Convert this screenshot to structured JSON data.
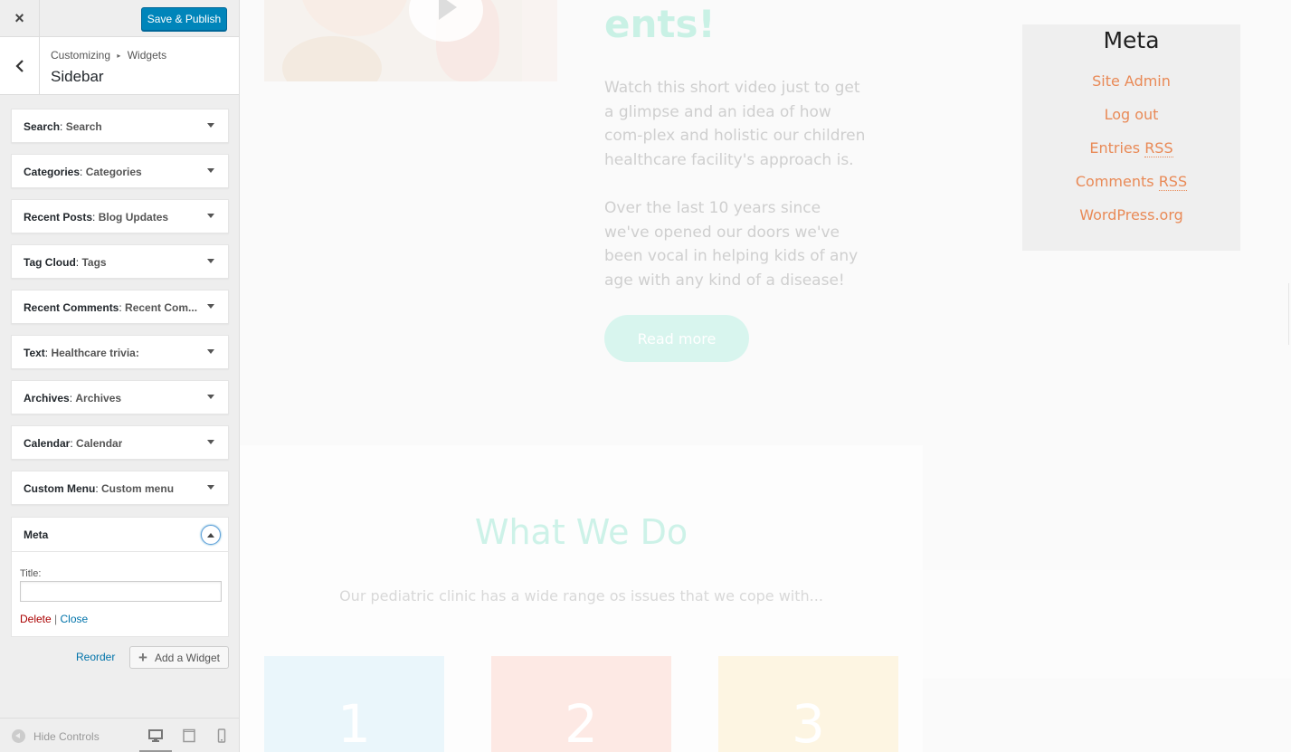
{
  "customizer": {
    "close_icon": "×",
    "save_label": "Save & Publish",
    "breadcrumb": [
      "Customizing",
      "Widgets"
    ],
    "breadcrumb_sep": "▸",
    "section_title": "Sidebar",
    "widgets": [
      {
        "name": "Search",
        "title": "Search"
      },
      {
        "name": "Categories",
        "title": "Categories"
      },
      {
        "name": "Recent Posts",
        "title": "Blog Updates"
      },
      {
        "name": "Tag Cloud",
        "title": "Tags"
      },
      {
        "name": "Recent Comments",
        "title": "Recent Com..."
      },
      {
        "name": "Text",
        "title": "Healthcare trivia:"
      },
      {
        "name": "Archives",
        "title": "Archives"
      },
      {
        "name": "Calendar",
        "title": "Calendar"
      },
      {
        "name": "Custom Menu",
        "title": "Custom menu"
      }
    ],
    "open_widget": {
      "name": "Meta",
      "field_label": "Title:",
      "field_value": "",
      "delete_label": "Delete",
      "separator": "|",
      "close_label": "Close"
    },
    "reorder_label": "Reorder",
    "add_widget_label": "Add a Widget",
    "hide_controls_label": "Hide Controls",
    "devices": [
      "desktop-icon",
      "tablet-icon",
      "mobile-icon"
    ],
    "accent_color": "#0085ba"
  },
  "preview": {
    "headline_fragment": "ents!",
    "paragraph_1": "Watch this short video just to get a glimpse and an idea of how com-plex and holistic our children healthcare facility's approach is.",
    "paragraph_2": "Over the last 10 years since we've opened our doors we've been vocal in helping kids of any age with any kind of a disease!",
    "read_more": "Read more",
    "meta_widget": {
      "title": "Meta",
      "links": [
        {
          "text": "Site Admin"
        },
        {
          "text": "Log out"
        },
        {
          "text": "Entries ",
          "abbr": "RSS"
        },
        {
          "text": "Comments ",
          "abbr": "RSS"
        },
        {
          "text": "WordPress.org"
        }
      ],
      "link_color": "#e98a57"
    },
    "what_we_do": {
      "title": "What We Do",
      "subtitle": "Our pediatric clinic has a wide range os issues that we cope with...",
      "tiles": [
        {
          "number": "1",
          "color": "#eaf6fb"
        },
        {
          "number": "2",
          "color": "#fde9e4"
        },
        {
          "number": "3",
          "color": "#fdf5e2"
        }
      ]
    }
  }
}
